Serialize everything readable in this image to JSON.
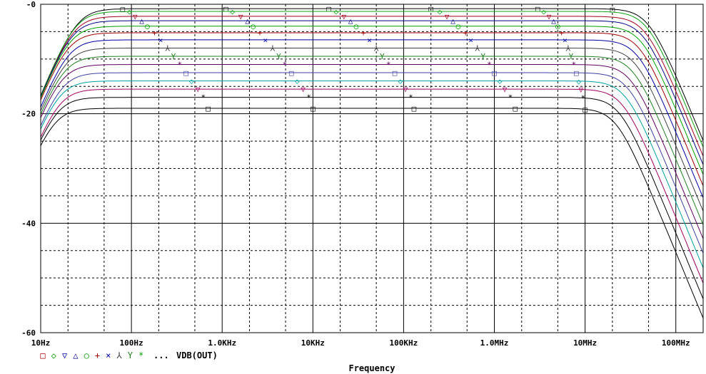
{
  "chart_data": {
    "type": "line",
    "title": "",
    "xlabel": "Frequency",
    "ylabel": "",
    "x_scale": "log",
    "xlim": [
      10,
      200000000
    ],
    "ylim": [
      -60,
      0
    ],
    "grid": true,
    "legend": "bottom-left",
    "x_ticks": [
      {
        "value": 10,
        "label": "10Hz"
      },
      {
        "value": 100,
        "label": "100Hz"
      },
      {
        "value": 1000,
        "label": "1.0KHz"
      },
      {
        "value": 10000,
        "label": "10KHz"
      },
      {
        "value": 100000,
        "label": "100KHz"
      },
      {
        "value": 1000000,
        "label": "1.0MHz"
      },
      {
        "value": 10000000,
        "label": "10MHz"
      },
      {
        "value": 100000000,
        "label": "100MHz"
      }
    ],
    "y_ticks": [
      {
        "value": 0,
        "label": "-0"
      },
      {
        "value": -20,
        "label": "-20"
      },
      {
        "value": -40,
        "label": "-40"
      },
      {
        "value": -60,
        "label": "-60"
      }
    ],
    "legend_markers": [
      "□",
      "◇",
      "▽",
      "△",
      "○",
      "+",
      "×",
      "⅄",
      "Y",
      "*"
    ],
    "legend_suffix": "...",
    "trace_label": "VDB(OUT)",
    "series": [
      {
        "color": "#000000",
        "mark": "□",
        "flat": -0.8,
        "f_low": 25,
        "f_high": 50000000,
        "mx": [
          80,
          1100,
          15000,
          200000,
          3000000,
          20000000
        ]
      },
      {
        "color": "#10a010",
        "mark": "◇",
        "flat": -1.3,
        "f_low": 24,
        "f_high": 48000000,
        "mx": [
          95,
          1300,
          18000,
          250000,
          3500000
        ]
      },
      {
        "color": "#a00020",
        "mark": "▽",
        "flat": -2.2,
        "f_low": 23,
        "f_high": 46000000,
        "mx": [
          110,
          1600,
          22000,
          300000,
          4000000
        ]
      },
      {
        "color": "#000080",
        "mark": "△",
        "flat": -3.0,
        "f_low": 22,
        "f_high": 44000000,
        "mx": [
          130,
          1900,
          26000,
          350000,
          4500000
        ]
      },
      {
        "color": "#00a000",
        "mark": "○",
        "flat": -4.0,
        "f_low": 21,
        "f_high": 42000000,
        "mx": [
          150,
          2200,
          30000,
          400000,
          5000000
        ]
      },
      {
        "color": "#a00000",
        "mark": "+",
        "flat": -5.2,
        "f_low": 20,
        "f_high": 40000000,
        "mx": [
          180,
          2600,
          36000,
          480000,
          5500000
        ]
      },
      {
        "color": "#0000a0",
        "mark": "×",
        "flat": -6.5,
        "f_low": 20,
        "f_high": 38000000,
        "mx": [
          210,
          3000,
          42000,
          550000,
          6000000
        ]
      },
      {
        "color": "#404040",
        "mark": "⅄",
        "flat": -8.0,
        "f_low": 19,
        "f_high": 36000000,
        "mx": [
          250,
          3600,
          50000,
          650000,
          6500000
        ]
      },
      {
        "color": "#208020",
        "mark": "Y",
        "flat": -9.5,
        "f_low": 18,
        "f_high": 34000000,
        "mx": [
          290,
          4200,
          58000,
          750000,
          7000000
        ]
      },
      {
        "color": "#600060",
        "mark": "*",
        "flat": -11.0,
        "f_low": 17,
        "f_high": 32000000,
        "mx": [
          340,
          4900,
          68000,
          880000,
          7500000
        ]
      },
      {
        "color": "#4040a0",
        "mark": "□",
        "flat": -12.5,
        "f_low": 17,
        "f_high": 30000000,
        "mx": [
          400,
          5800,
          80000,
          1000000,
          8000000
        ]
      },
      {
        "color": "#00a0a0",
        "mark": "◇",
        "flat": -14.0,
        "f_low": 16,
        "f_high": 28000000,
        "mx": [
          460,
          6700,
          92000,
          1150000,
          8500000
        ]
      },
      {
        "color": "#a00060",
        "mark": "▽",
        "flat": -15.5,
        "f_low": 16,
        "f_high": 26000000,
        "mx": [
          540,
          7800,
          105000,
          1300000,
          9000000
        ]
      },
      {
        "color": "#000000",
        "mark": "*",
        "flat": -17.0,
        "f_low": 15,
        "f_high": 24000000,
        "mx": [
          620,
          9000,
          120000,
          1500000,
          9500000
        ]
      },
      {
        "color": "#000000",
        "mark": "□",
        "flat": -19.0,
        "f_low": 14,
        "f_high": 22000000,
        "mx": [
          700,
          10000,
          130000,
          1700000,
          10000000
        ]
      }
    ]
  }
}
